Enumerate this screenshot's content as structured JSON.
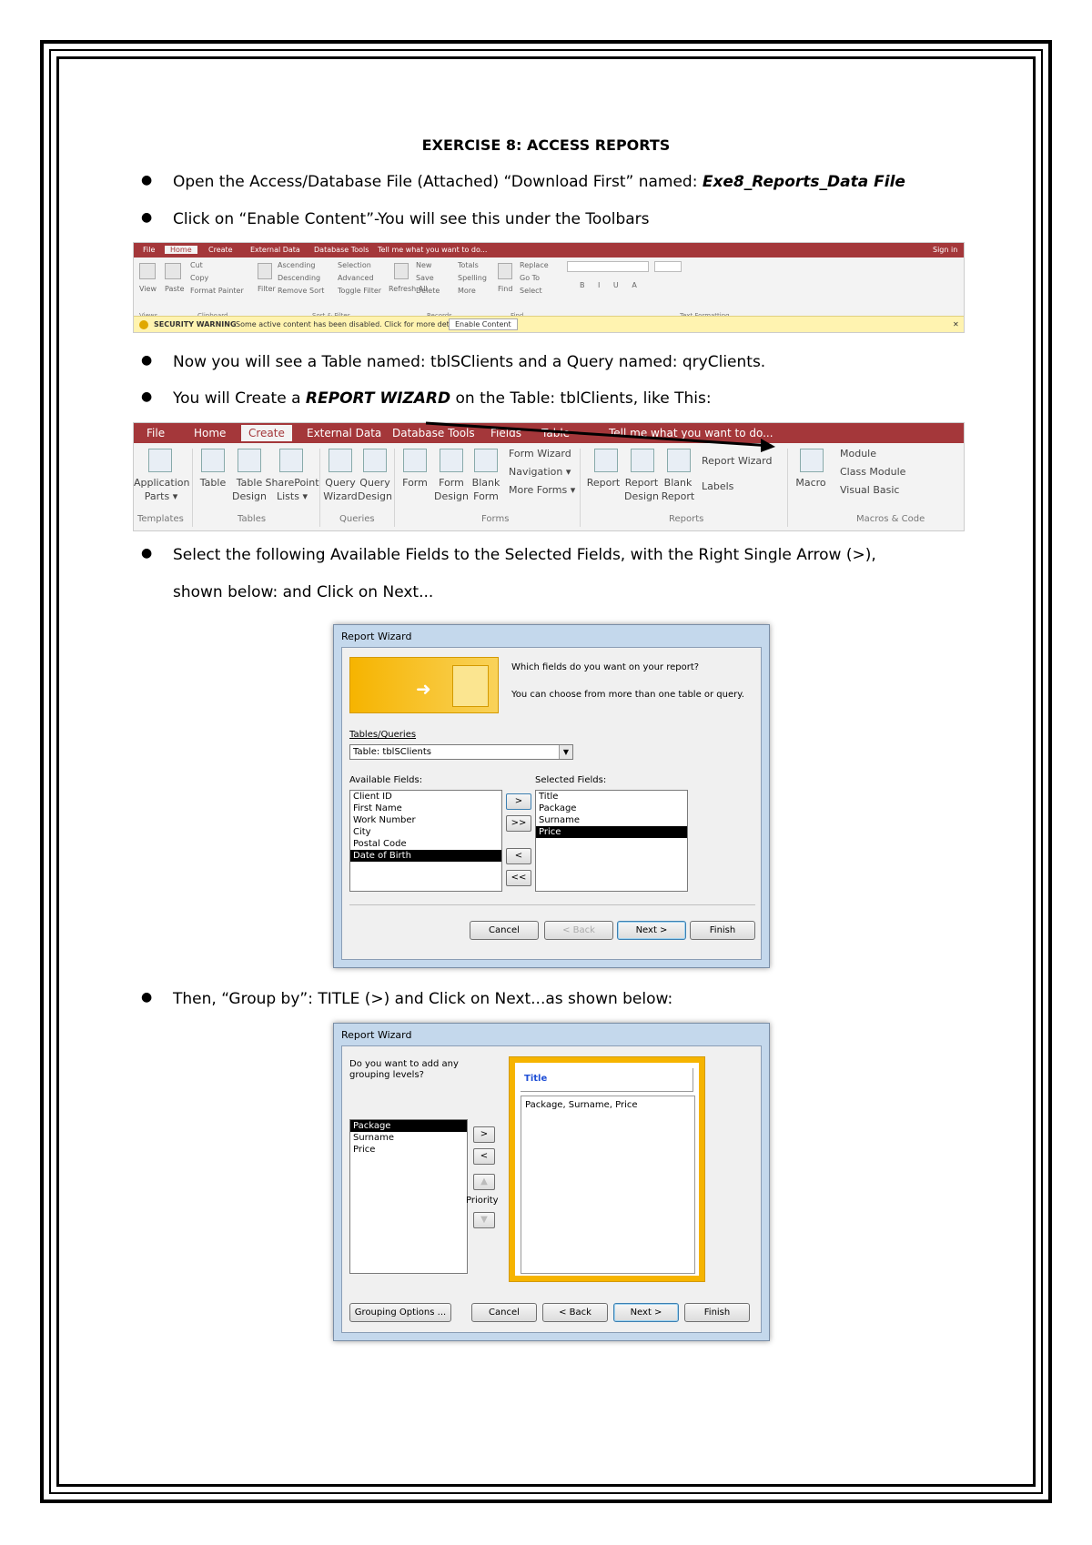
{
  "page": {
    "title": "EXERCISE 8: ACCESS REPORTS",
    "bullets": [
      {
        "pre": "Open the Access/Database File (Attached) “Download First” named: ",
        "em": "Exe8_Reports_Data File"
      },
      {
        "text": "Click on “Enable Content”-You will see this under the Toolbars"
      },
      {
        "text": "Now you will see a Table named: tblSClients and a Query named: qryClients."
      },
      {
        "pre": "You will Create a ",
        "em": "REPORT WIZARD",
        "post": " on the Table: tblClients, like This:"
      },
      {
        "text": "Select the following Available Fields to the Selected Fields, with the Right Single Arrow (>),",
        "cont": "shown below: and Click on Next..."
      },
      {
        "text": "Then, “Group by”: TITLE (>) and Click on Next...as shown below:"
      }
    ]
  },
  "ribbon1": {
    "tabs": [
      "File",
      "Home",
      "Create",
      "External Data",
      "Database Tools",
      "Tell me what you want to do..."
    ],
    "sign_in": "Sign in",
    "items": [
      "Cut",
      "Copy",
      "Format Painter",
      "Ascending",
      "Descending",
      "Remove Sort",
      "Selection",
      "Advanced",
      "Toggle Filter",
      "New",
      "Save",
      "Delete",
      "Totals",
      "Spelling",
      "More",
      "Replace",
      "Go To",
      "Select",
      "View",
      "Paste",
      "Filter",
      "Refresh All",
      "Find"
    ],
    "groups": [
      "Views",
      "Clipboard",
      "Sort & Filter",
      "Records",
      "Find",
      "Text Formatting"
    ],
    "security_label": "SECURITY WARNING",
    "security_text": "Some active content has been disabled. Click for more details.",
    "enable_button": "Enable Content"
  },
  "ribbon2": {
    "tabs": [
      "File",
      "Home",
      "Create",
      "External Data",
      "Database Tools",
      "Fields",
      "Table",
      "Tell me what you want to do..."
    ],
    "items": {
      "app_parts": "Application\nParts ▾",
      "table": "Table",
      "table_design": "Table\nDesign",
      "sharepoint": "SharePoint\nLists ▾",
      "query_wizard": "Query\nWizard",
      "query_design": "Query\nDesign",
      "form": "Form",
      "form_design": "Form\nDesign",
      "blank_form": "Blank\nForm",
      "form_wizard": "Form Wizard",
      "navigation": "Navigation ▾",
      "more_forms": "More Forms ▾",
      "report": "Report",
      "report_design": "Report\nDesign",
      "blank_report": "Blank\nReport",
      "report_wizard": "Report Wizard",
      "labels": "Labels",
      "macro": "Macro",
      "module": "Module",
      "class_module": "Class Module",
      "visual_basic": "Visual Basic"
    },
    "groups": [
      "Templates",
      "Tables",
      "Queries",
      "Forms",
      "Reports",
      "Macros & Code"
    ]
  },
  "wizard1": {
    "title": "Report Wizard",
    "question": "Which fields do you want on your report?",
    "hint": "You can choose from more than one table or query.",
    "tables_label": "Tables/Queries",
    "table_value": "Table: tblSClients",
    "available_label": "Available Fields:",
    "selected_label": "Selected Fields:",
    "available": [
      "Client ID",
      "First Name",
      "Work Number",
      "City",
      "Postal Code",
      "Date of Birth"
    ],
    "selected": [
      "Title",
      "Package",
      "Surname",
      "Price"
    ],
    "move": [
      ">",
      ">>",
      "<",
      "<<"
    ],
    "buttons": {
      "cancel": "Cancel",
      "back": "< Back",
      "next": "Next >",
      "finish": "Finish"
    }
  },
  "wizard2": {
    "title": "Report Wizard",
    "question": "Do you want to add any grouping levels?",
    "fields": [
      "Package",
      "Surname",
      "Price"
    ],
    "group_field": "Title",
    "group_detail": "Package, Surname, Price",
    "move": [
      ">",
      "<"
    ],
    "priority": "Priority",
    "buttons": {
      "grouping": "Grouping Options ...",
      "cancel": "Cancel",
      "back": "< Back",
      "next": "Next >",
      "finish": "Finish"
    }
  }
}
